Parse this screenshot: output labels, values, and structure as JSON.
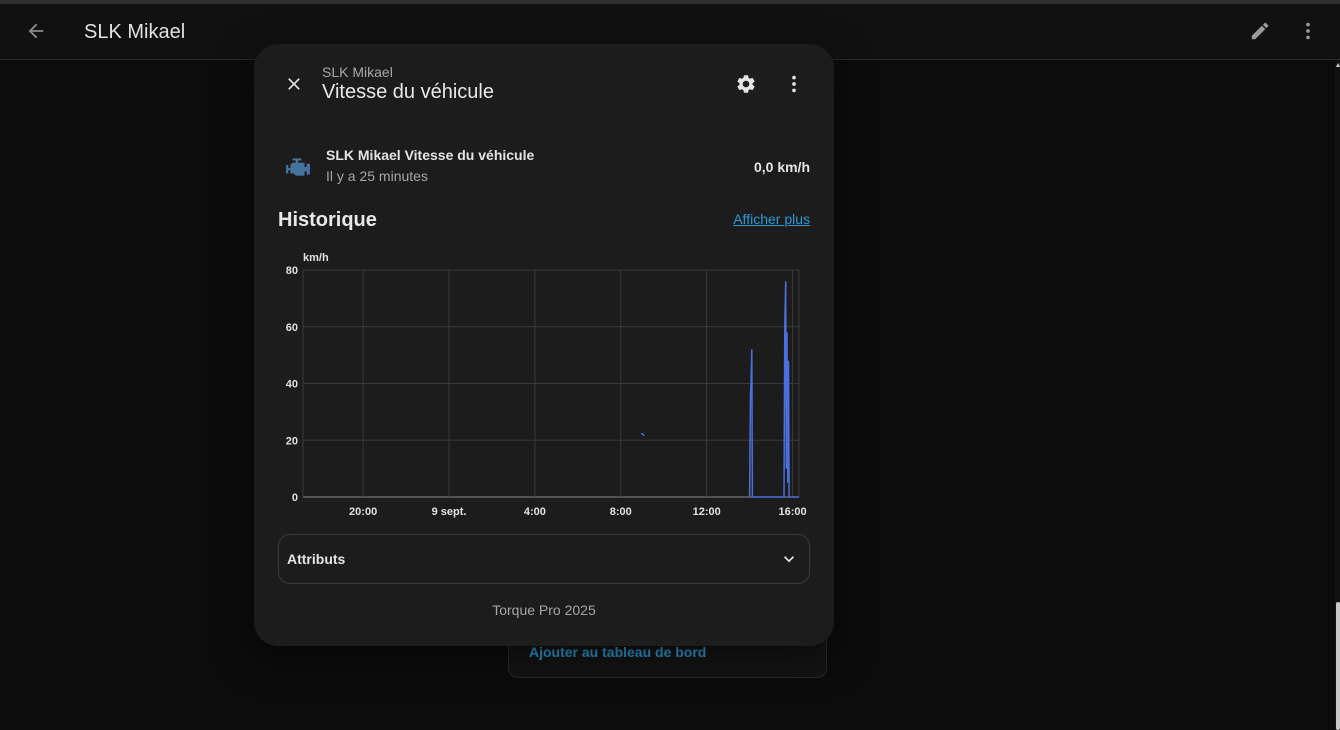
{
  "app": {
    "title": "SLK Mikael",
    "icons": {
      "back": "arrow-left-icon",
      "edit": "pencil-icon",
      "menu": "dots-vertical-icon"
    }
  },
  "background_card": {
    "add_to_dashboard": "Ajouter au tableau de bord"
  },
  "dialog": {
    "subtitle": "SLK Mikael",
    "title": "Vitesse du véhicule",
    "icons": {
      "close": "close-icon",
      "settings": "gear-icon",
      "menu": "dots-vertical-icon"
    },
    "entity": {
      "icon": "engine-icon",
      "name": "SLK Mikael Vitesse du véhicule",
      "last_changed": "Il y a 25 minutes",
      "value": "0,0 km/h"
    },
    "history": {
      "title": "Historique",
      "show_more": "Afficher plus"
    },
    "attributes": {
      "label": "Attributs",
      "icon": "chevron-down-icon"
    },
    "footer": "Torque Pro 2025"
  },
  "colors": {
    "accent": "#2a9bd6",
    "series": "#4b6fde",
    "entity_icon": "#44739e"
  },
  "chart_data": {
    "type": "line",
    "ylabel": "km/h",
    "ylim": [
      0,
      80
    ],
    "yticks": [
      0,
      20,
      40,
      60,
      80
    ],
    "xticks": [
      "20:00",
      "9 sept.",
      "4:00",
      "8:00",
      "12:00",
      "16:00"
    ],
    "xtick_hours": [
      20,
      24,
      28,
      32,
      36,
      40
    ],
    "xlim_hours": [
      17.2,
      40.3
    ],
    "grid": true,
    "series": [
      {
        "points": [
          [
            32.95,
            22.5
          ],
          [
            33.05,
            22.0
          ],
          [
            33.09,
            21.5
          ]
        ]
      },
      {
        "points": [
          [
            38.0,
            0
          ],
          [
            38.04,
            37
          ],
          [
            38.06,
            38
          ],
          [
            38.1,
            52
          ],
          [
            38.13,
            0
          ],
          [
            39.6,
            0
          ],
          [
            39.64,
            60
          ],
          [
            39.68,
            76
          ],
          [
            39.71,
            10
          ],
          [
            39.74,
            58
          ],
          [
            39.78,
            5
          ],
          [
            39.81,
            48
          ],
          [
            39.84,
            0
          ],
          [
            40.3,
            0
          ]
        ]
      }
    ]
  }
}
